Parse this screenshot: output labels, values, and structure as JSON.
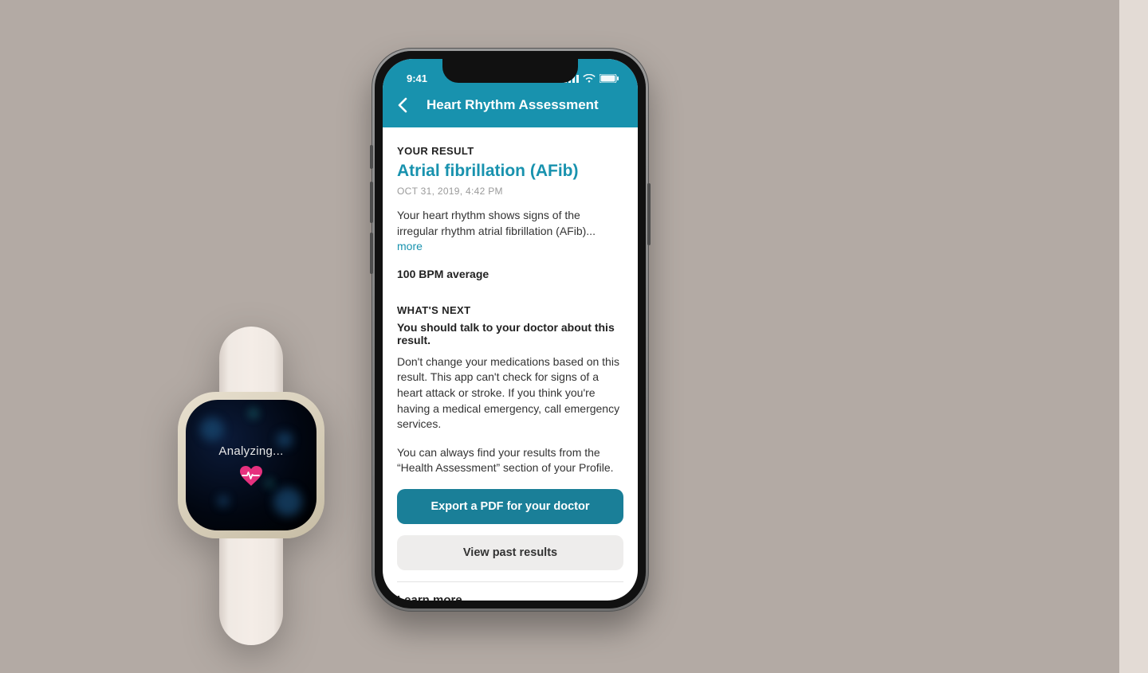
{
  "colors": {
    "teal": "#1892ae",
    "tealDark": "#1a7f98",
    "heart": "#e6317e"
  },
  "watch": {
    "status_text": "Analyzing...",
    "icon": "heart-pulse-icon"
  },
  "phone": {
    "status_bar": {
      "time": "9:41",
      "signal_icon": "cellular-signal-icon",
      "wifi_icon": "wifi-icon",
      "battery_icon": "battery-icon"
    },
    "header": {
      "back_icon": "chevron-left-icon",
      "title": "Heart Rhythm Assessment"
    },
    "result": {
      "label": "YOUR RESULT",
      "diagnosis": "Atrial fibrillation (AFib)",
      "timestamp": "OCT 31, 2019, 4:42 PM",
      "description": "Your heart rhythm shows signs of the irregular rhythm atrial fibrillation (AFib)... ",
      "more_label": "more",
      "bpm_line": "100 BPM average"
    },
    "next": {
      "label": "WHAT'S NEXT",
      "headline": "You should talk to your doctor about this result.",
      "para1": "Don't change your medications based on this result. This app can't check for signs of a heart attack or stroke. If you think you're having a medical emergency, call emergency services.",
      "para2": "You can always find your results from the “Health Assessment” section of your Profile."
    },
    "buttons": {
      "export": "Export a PDF for your doctor",
      "past": "View past results"
    },
    "learn_more": "Learn more"
  }
}
